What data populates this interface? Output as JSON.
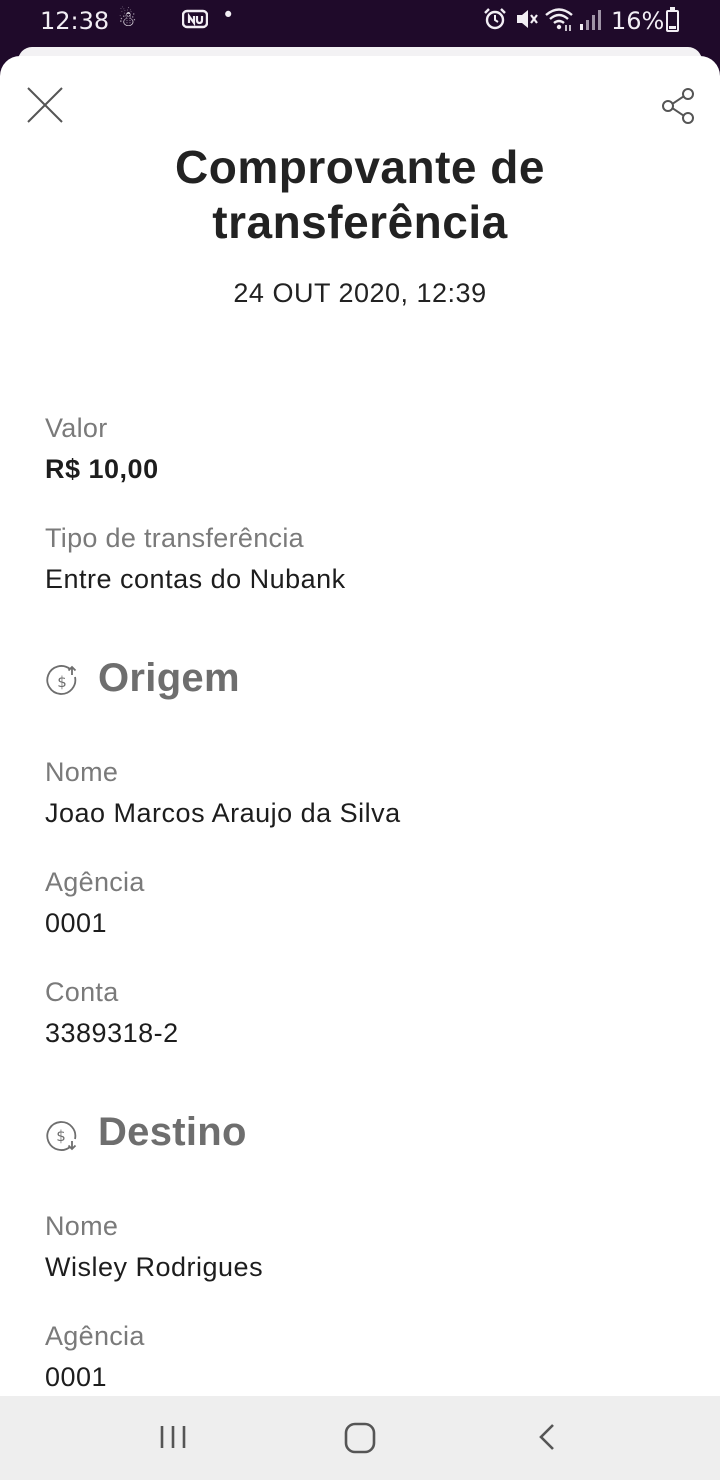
{
  "status_bar": {
    "time": "12:38",
    "battery_percent": "16%",
    "icons": [
      "person-notification-icon",
      "nubank-notification-icon",
      "dot-icon",
      "alarm-icon",
      "mute-icon",
      "wifi-icon",
      "signal-icon",
      "battery-icon"
    ]
  },
  "header": {
    "close_icon": "close-icon",
    "share_icon": "share-icon"
  },
  "receipt": {
    "title_line1": "Comprovante de",
    "title_line2": "transferência",
    "datetime": "24 OUT 2020, 12:39",
    "value_label": "Valor",
    "value": "R$ 10,00",
    "type_label": "Tipo de transferência",
    "type": "Entre contas do Nubank"
  },
  "origin": {
    "heading": "Origem",
    "icon": "money-out-icon",
    "name_label": "Nome",
    "name": "Joao Marcos Araujo da Silva",
    "agency_label": "Agência",
    "agency": "0001",
    "account_label": "Conta",
    "account": "3389318-2"
  },
  "destination": {
    "heading": "Destino",
    "icon": "money-in-icon",
    "name_label": "Nome",
    "name": "Wisley Rodrigues",
    "agency_label": "Agência",
    "agency": "0001"
  },
  "nav": {
    "icons": [
      "recent-apps-icon",
      "home-icon",
      "back-icon"
    ]
  },
  "colors": {
    "status_bar_bg": "#1f0a2a",
    "title_text": "#222222",
    "label_text": "#7a7a7a",
    "section_heading": "#6e6e6e",
    "nav_bg": "#eeeeee"
  }
}
